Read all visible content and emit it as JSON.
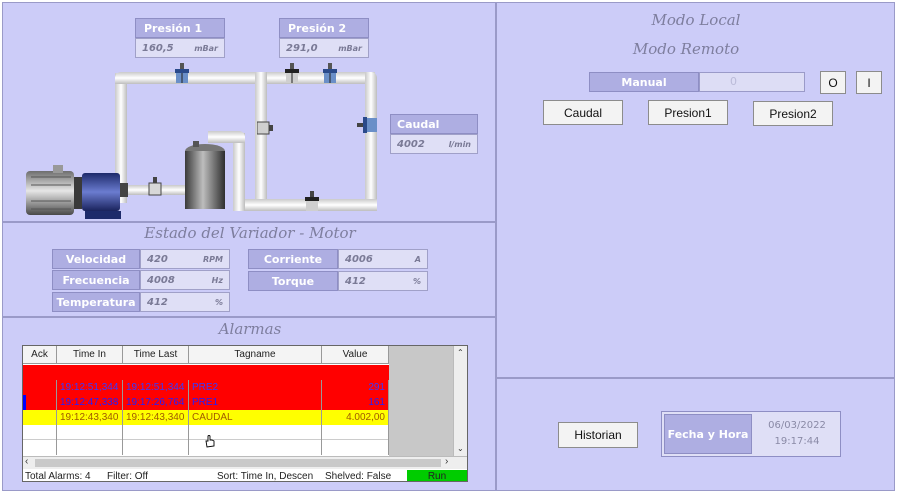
{
  "colors": {
    "panel_bg": "#ccccf8",
    "label_bg": "#aeaee2",
    "value_bg": "#dfdff6",
    "alarm_red": "#ff0000",
    "alarm_yellow": "#ffff00",
    "alarm_selected": "#0000ff",
    "run_green": "#00cc00"
  },
  "pressure1": {
    "label": "Presión 1",
    "value": "160,5",
    "unit": "mBar"
  },
  "pressure2": {
    "label": "Presión 2",
    "value": "291,0",
    "unit": "mBar"
  },
  "flow": {
    "label": "Caudal",
    "value": "4002",
    "unit": "l/min"
  },
  "drive": {
    "title": "Estado del Variador - Motor",
    "speed": {
      "label": "Velocidad",
      "value": "420",
      "unit": "RPM"
    },
    "frequency": {
      "label": "Frecuencia",
      "value": "4008",
      "unit": "Hz"
    },
    "temperature": {
      "label": "Temperatura",
      "value": "412",
      "unit": "%"
    },
    "current": {
      "label": "Corriente",
      "value": "4006",
      "unit": "A"
    },
    "torque": {
      "label": "Torque",
      "value": "412",
      "unit": "%"
    }
  },
  "alarms": {
    "title": "Alarmas",
    "columns": [
      "Ack",
      "Time In",
      "Time Last",
      "Tagname",
      "Value"
    ],
    "rows": [
      {
        "ack": "",
        "time_in": "",
        "time_last": "",
        "tag": "",
        "value": "",
        "style": "red"
      },
      {
        "ack": "",
        "time_in": "19:12:51,344",
        "time_last": "19:12:51,344",
        "tag": "PRE2",
        "value": "291",
        "style": "red"
      },
      {
        "ack": "",
        "time_in": "19:12:47,338",
        "time_last": "19:17:26,764",
        "tag": "PRE1",
        "value": "161",
        "style": "selected"
      },
      {
        "ack": "",
        "time_in": "19:12:43,340",
        "time_last": "19:12:43,340",
        "tag": "CAUDAL",
        "value": "4.002,00",
        "style": "yellow"
      },
      {
        "ack": "",
        "time_in": "",
        "time_last": "",
        "tag": "",
        "value": "",
        "style": "white"
      },
      {
        "ack": "",
        "time_in": "",
        "time_last": "",
        "tag": "",
        "value": "",
        "style": "white"
      }
    ],
    "footer": {
      "total": "Total Alarms: 4",
      "filter": "Filter: Off",
      "sort": "Sort: Time In, Descen",
      "shelved": "Shelved: False",
      "run": "Run"
    }
  },
  "mode": {
    "local": "Modo Local",
    "remote": "Modo Remoto",
    "manual": "Manual",
    "slider_mark": "0",
    "btn_o": "O",
    "btn_i": "I"
  },
  "buttons": {
    "caudal": "Caudal",
    "presion1": "Presion1",
    "presion2": "Presion2",
    "historian": "Historian"
  },
  "datetime": {
    "label": "Fecha y Hora",
    "date": "06/03/2022",
    "time": "19:17:44"
  }
}
